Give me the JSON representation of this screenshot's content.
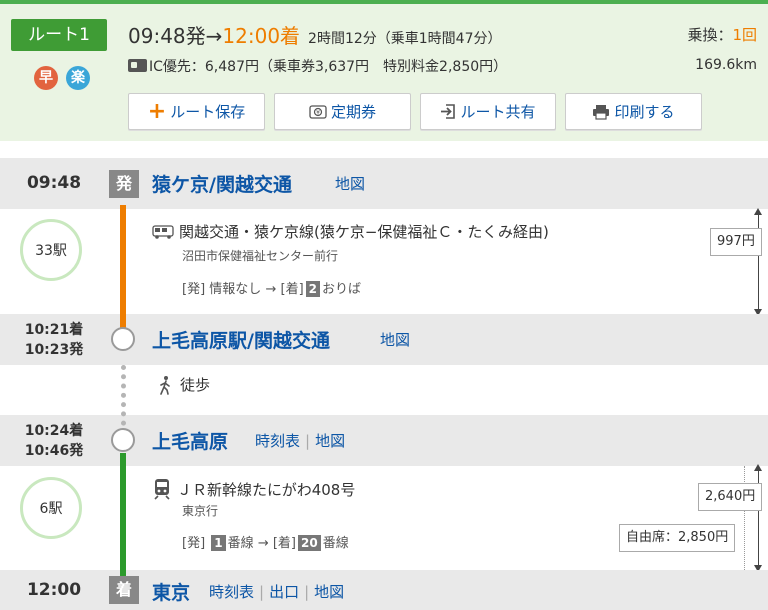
{
  "summary": {
    "route_label": "ルート1",
    "badge_fast": "早",
    "badge_easy": "楽",
    "dep_time": "09:48発",
    "arrow": "→",
    "arr_time": "12:00着",
    "duration": "2時間12分（乗車1時間47分）",
    "transfers_label": "乗換：",
    "transfers_count": "1回",
    "fare_line": "IC優先：6,487円（乗車券3,637円　特別料金2,850円）",
    "distance": "169.6km",
    "actions": {
      "save": "ルート保存",
      "pass": "定期券",
      "share": "ルート共有",
      "print": "印刷する"
    }
  },
  "stations": [
    {
      "time": "09:48",
      "marker": "発",
      "name": "猿ケ京/関越交通",
      "links": [
        "地図"
      ]
    },
    {
      "time_arr": "10:21着",
      "time_dep": "10:23発",
      "name": "上毛高原駅/関越交通",
      "links": [
        "地図"
      ]
    },
    {
      "time_arr": "10:24着",
      "time_dep": "10:46発",
      "name": "上毛高原",
      "links": [
        "時刻表",
        "地図"
      ]
    },
    {
      "time": "12:00",
      "marker": "着",
      "name": "東京",
      "links": [
        "時刻表",
        "出口",
        "地図"
      ]
    }
  ],
  "segments": {
    "bus": {
      "stops": "33駅",
      "title": "関越交通・猿ケ京線(猿ケ京−保健福祉Ｃ・たくみ経由)",
      "direction": "沼田市保健福祉センター前行",
      "plat_dep_label": "[発]",
      "plat_dep_value": "情報なし",
      "plat_arrow": "→",
      "plat_arr_label": "[着]",
      "plat_arr_num": "2",
      "plat_arr_suffix": "おりば",
      "fare": "997円"
    },
    "walk": {
      "title": "徒歩"
    },
    "train": {
      "stops": "6駅",
      "title": "ＪＲ新幹線たにがわ408号",
      "direction": "東京行",
      "plat_dep_label": "[発]",
      "plat_dep_num": "1",
      "plat_dep_suffix": "番線",
      "plat_arrow": "→",
      "plat_arr_label": "[着]",
      "plat_arr_num": "20",
      "plat_arr_suffix": "番線",
      "fare": "2,640円",
      "express_fare": "自由席：2,850円"
    }
  },
  "colors": {
    "accent_orange": "#ee7d00",
    "bus_line": "#ee7d00",
    "train_line": "#2b9a2b",
    "link_blue": "#0d56a6",
    "route_tab_green": "#3f9c35"
  },
  "icons": {
    "badge_fast": "fast-badge-icon",
    "badge_easy": "easy-badge-icon",
    "ic": "ic-card-icon",
    "save": "plus-icon",
    "pass": "commuter-pass-icon",
    "share": "share-icon",
    "print": "printer-icon",
    "bus": "bus-icon",
    "walk": "walking-person-icon",
    "train": "train-icon"
  }
}
